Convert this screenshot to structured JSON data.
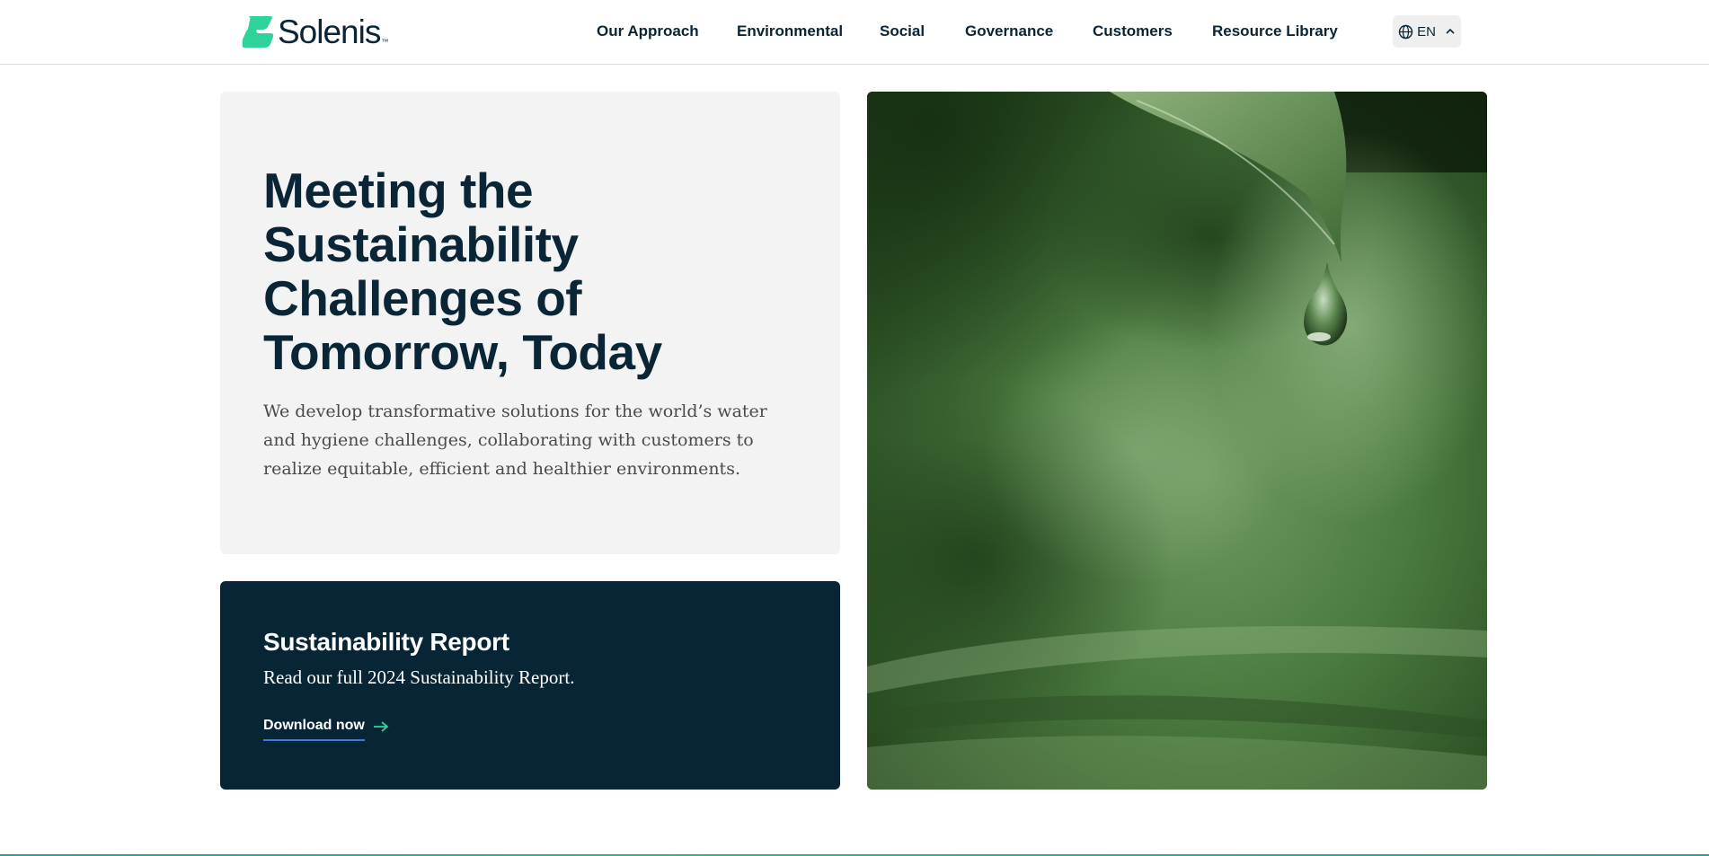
{
  "brand": {
    "name": "Solenis",
    "tm": "™",
    "accent_color": "#2fd39a",
    "navy_color": "#0a2535"
  },
  "nav": {
    "items": [
      {
        "label": "Our Approach"
      },
      {
        "label": "Environmental"
      },
      {
        "label": "Social"
      },
      {
        "label": "Governance"
      },
      {
        "label": "Customers"
      },
      {
        "label": "Resource Library"
      }
    ]
  },
  "language": {
    "icon": "globe-icon",
    "label": "EN",
    "chevron_icon": "chevron-up-icon"
  },
  "hero": {
    "title_lines": [
      "Meeting the",
      "Sustainability",
      "Challenges of",
      "Tomorrow, Today"
    ],
    "description": "We develop transformative solutions for the world’s water and hygiene challenges, collaborating with customers to realize equitable, efficient and healthier environments."
  },
  "report": {
    "title": "Sustainability Report",
    "subtitle": "Read our full 2024 Sustainability Report.",
    "link_label": "Download now",
    "link_icon": "arrow-right-icon"
  },
  "image": {
    "subject": "leaf-water-droplet-image"
  }
}
